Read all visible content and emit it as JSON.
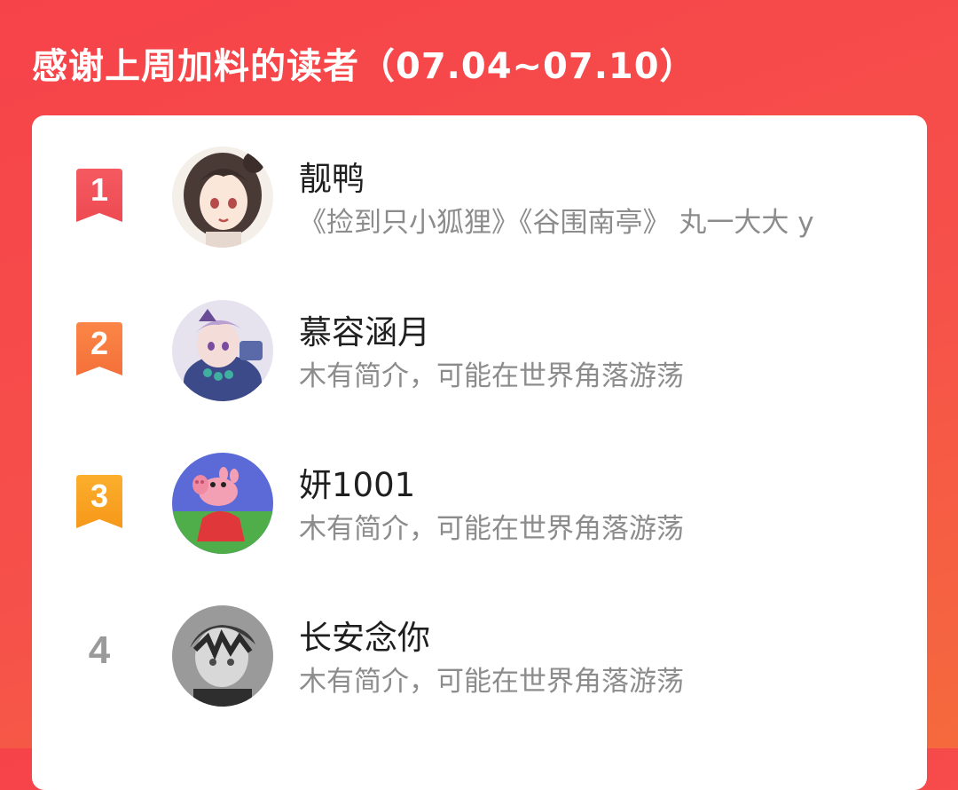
{
  "header": {
    "title": "感谢上周加料的读者（07.04~07.10）"
  },
  "colors": {
    "background_top": "#f6434a",
    "background_bottom": "#f56a3d",
    "rank1": "#f04e56",
    "rank2": "#f8763f",
    "rank3": "#f8a11a",
    "rank_plain": "#9a9a9a"
  },
  "readers": [
    {
      "rank": "1",
      "name": "靓鸭",
      "bio": "《捡到只小狐狸》《谷围南亭》 丸一大大 y",
      "avatar_icon": "anime-girl-avatar"
    },
    {
      "rank": "2",
      "name": "慕容涵月",
      "bio": "木有简介，可能在世界角落游荡",
      "avatar_icon": "anime-character-avatar"
    },
    {
      "rank": "3",
      "name": "妍1001",
      "bio": "木有简介，可能在世界角落游荡",
      "avatar_icon": "cartoon-pig-avatar"
    },
    {
      "rank": "4",
      "name": "长安念你",
      "bio": "木有简介，可能在世界角落游荡",
      "avatar_icon": "grayscale-boy-avatar"
    }
  ]
}
